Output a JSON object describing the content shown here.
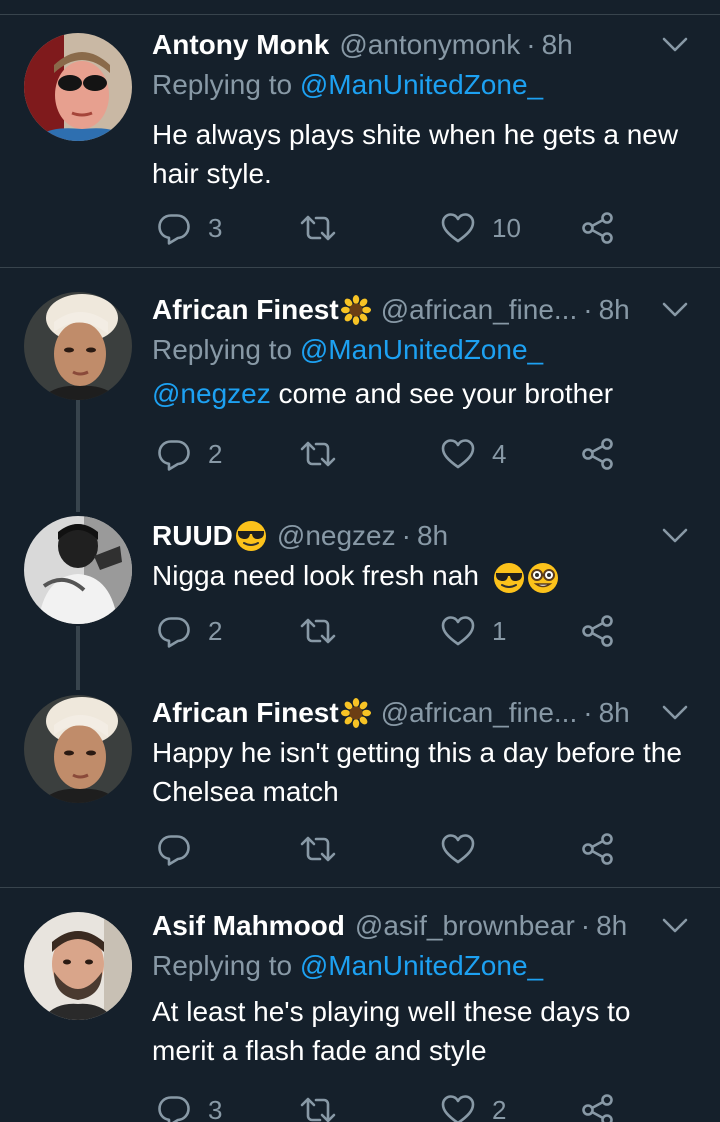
{
  "tweets": [
    {
      "name": "Antony Monk",
      "handle": "@antonymonk",
      "time": "8h",
      "replying_prefix": "Replying to",
      "replying_to": "@ManUnitedZone_",
      "mention": "",
      "text": "He always plays shite when he gets a new hair style.",
      "replies": "3",
      "retweets": "",
      "likes": "10"
    },
    {
      "name": "African Finest",
      "name_emoji": "sunflower",
      "handle": "@african_fine...",
      "time": "8h",
      "replying_prefix": "Replying to",
      "replying_to": "@ManUnitedZone_",
      "mention": "@negzez",
      "text": " come and see your brother",
      "replies": "2",
      "retweets": "",
      "likes": "4"
    },
    {
      "name": "RUUD",
      "name_emoji": "smiling-face-with-sunglasses",
      "handle": "@negzez",
      "time": "8h",
      "text": "Nigga need look fresh nah",
      "text_emojis": [
        "smiling-face-with-sunglasses",
        "nerd-face"
      ],
      "replies": "2",
      "retweets": "",
      "likes": "1"
    },
    {
      "name": "African Finest",
      "name_emoji": "sunflower",
      "handle": "@african_fine...",
      "time": "8h",
      "text": "Happy he isn't getting this a day before the Chelsea match",
      "replies": "",
      "retweets": "",
      "likes": ""
    },
    {
      "name": "Asif Mahmood",
      "handle": "@asif_brownbear",
      "time": "8h",
      "replying_prefix": "Replying to",
      "replying_to": "@ManUnitedZone_",
      "text": "At least he's playing well these days to merit a flash fade and style",
      "replies": "3",
      "retweets": "",
      "likes": "2"
    }
  ],
  "colors": {
    "background": "#15202b",
    "secondary_text": "#8899a6",
    "link": "#1da1f2",
    "divider": "#38444d"
  },
  "icons": [
    "reply-icon",
    "retweet-icon",
    "like-icon",
    "share-icon",
    "chevron-down-icon"
  ]
}
